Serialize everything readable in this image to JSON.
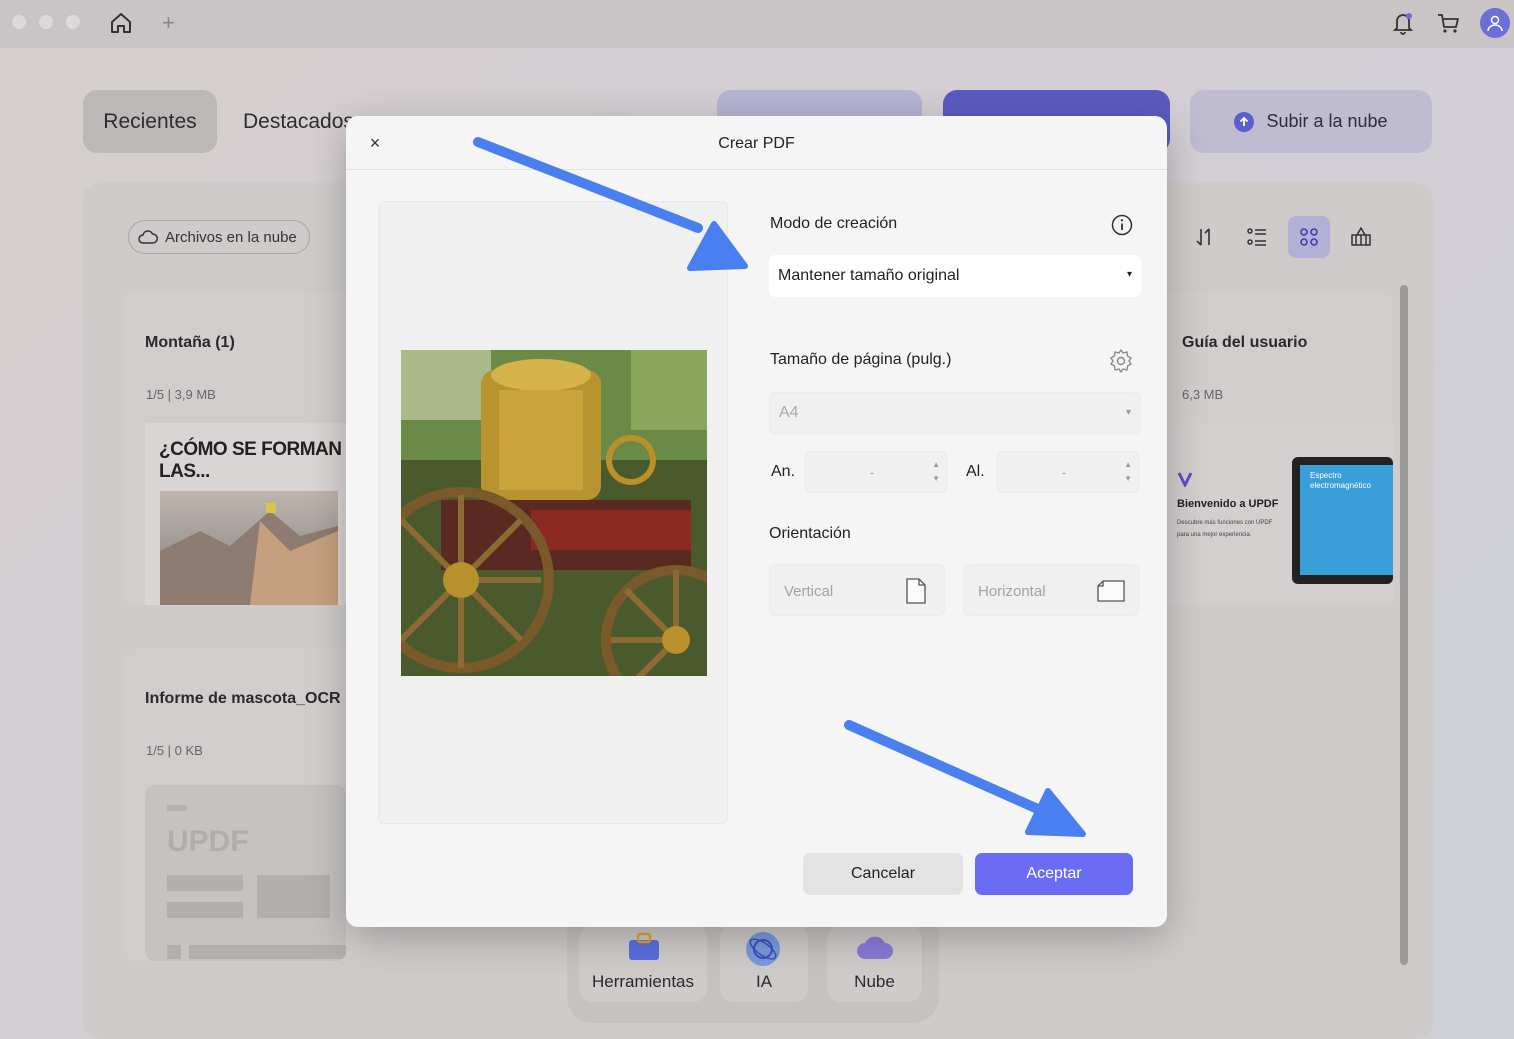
{
  "titlebar": {
    "icons": [
      "home-icon",
      "plus-icon",
      "bell-icon",
      "cart-icon",
      "user-avatar-icon"
    ],
    "plus": "+"
  },
  "tabs": [
    {
      "label": "Recientes"
    },
    {
      "label": "Destacados"
    }
  ],
  "header_buttons": {
    "upload_cloud": "Subir a la nube"
  },
  "cloud_files": "Archivos en la nube",
  "files": [
    {
      "title": "Montaña (1)",
      "meta": "1/5  |  3,9 MB",
      "thumb_text": "¿CÓMO SE FORMAN LAS..."
    },
    {
      "title": "Informe de mascota_OCR",
      "meta": "1/5  |  0 KB",
      "thumb_text": "UPDF"
    },
    {
      "title": "Guía del usuario",
      "meta": "6,3 MB",
      "thumb_text": "Bienvenido a UPDF",
      "thumb_sub": "Descubre más funciones con UPDF para una mejor experiencia.",
      "thumb_screen": "Espectro electromagnético"
    }
  ],
  "bottom_nav": [
    {
      "label": "Herramientas",
      "icon": "toolbox-icon"
    },
    {
      "label": "IA",
      "icon": "ai-icon"
    },
    {
      "label": "Nube",
      "icon": "cloud-icon"
    }
  ],
  "dialog": {
    "close": "×",
    "title": "Crear PDF",
    "creation_mode_label": "Modo de creación",
    "creation_mode_value": "Mantener tamaño original",
    "page_size_label": "Tamaño de página (pulg.)",
    "page_size_value": "A4",
    "width_label": "An.",
    "height_label": "Al.",
    "width_value": "-",
    "height_value": "-",
    "orientation_label": "Orientación",
    "orientation_vertical": "Vertical",
    "orientation_horizontal": "Horizontal",
    "cancel": "Cancelar",
    "accept": "Aceptar",
    "caret": "▾",
    "stepper_up": "▲",
    "stepper_down": "▼"
  },
  "colors": {
    "accent": "#6a6df4",
    "annotation_arrow": "#4a7ff0"
  }
}
